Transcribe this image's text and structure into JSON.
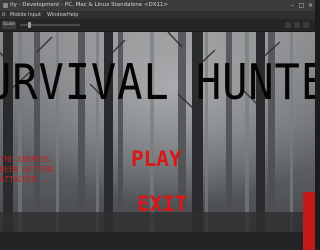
{
  "window": {
    "title": "ity - Development - PC, Mac & Linux Standalone <DX11>"
  },
  "menubar": {
    "items": [
      "it",
      "Mobile Input",
      "Window",
      "Help"
    ]
  },
  "toolbar": {
    "game_tab_label": "Scale"
  },
  "game": {
    "title": "URVIVAL HUNTE",
    "story_lines": "THE ENEMIES\nBEEN GETTING\nATTACKED...",
    "play_label": "PLAY",
    "exit_label": "EXIT"
  },
  "colors": {
    "menu_red": "#d81818",
    "title_black": "#050505",
    "forest_gray": "#5f6164"
  }
}
